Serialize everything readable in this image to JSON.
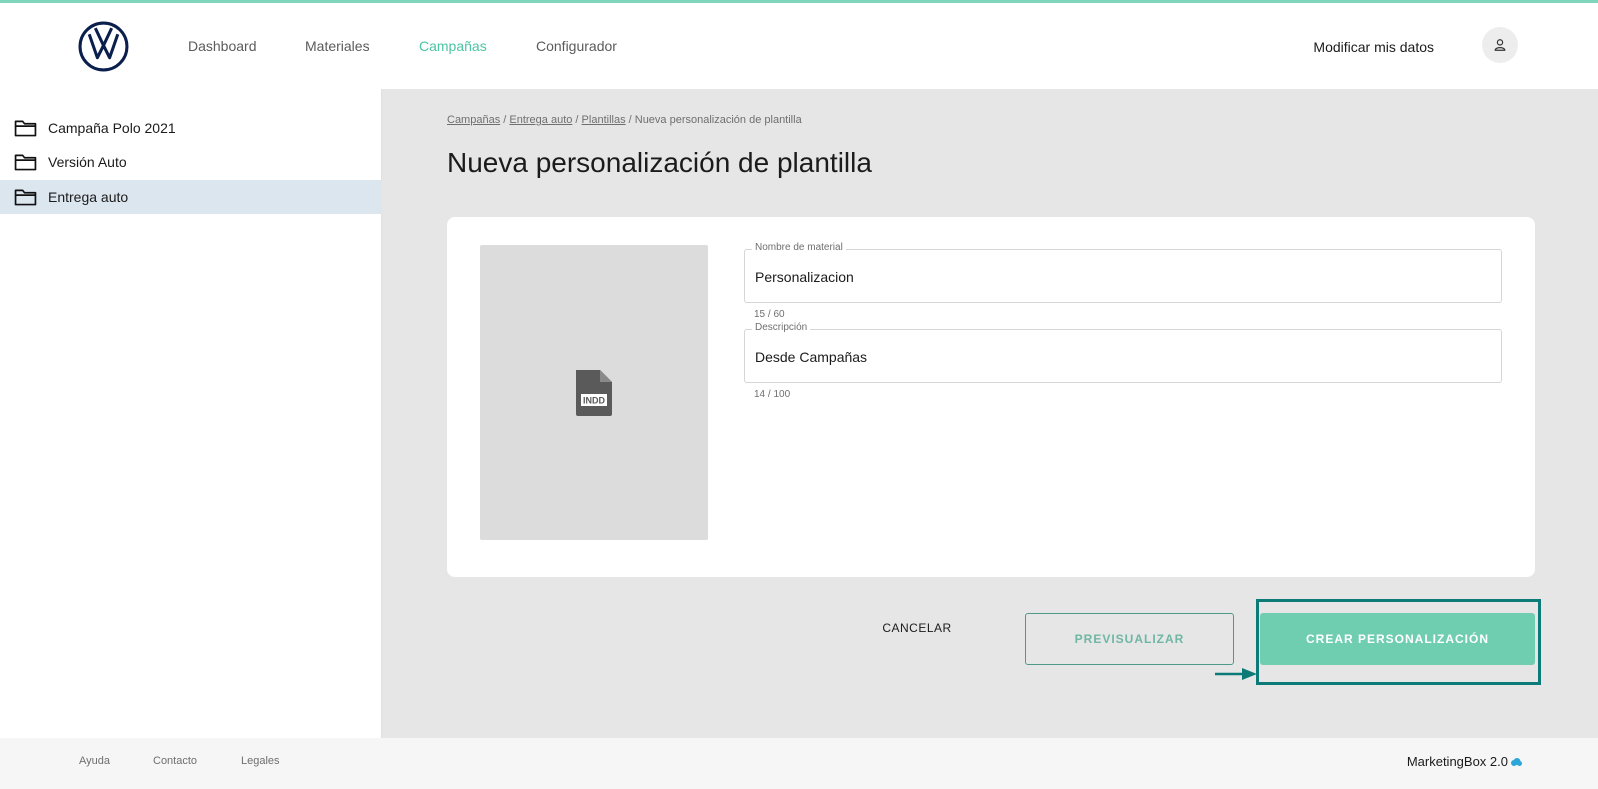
{
  "header": {
    "nav": [
      {
        "label": "Dashboard",
        "active": false
      },
      {
        "label": "Materiales",
        "active": false
      },
      {
        "label": "Campañas",
        "active": true
      },
      {
        "label": "Configurador",
        "active": false
      }
    ],
    "profile_label": "Modificar mis datos"
  },
  "sidebar": {
    "items": [
      {
        "label": "Campaña Polo 2021",
        "selected": false
      },
      {
        "label": "Versión Auto",
        "selected": false
      },
      {
        "label": "Entrega auto",
        "selected": true
      }
    ]
  },
  "main": {
    "breadcrumb": {
      "links": [
        "Campañas",
        "Entrega auto",
        "Plantillas"
      ],
      "separator": " / ",
      "current": "Nueva personalización de plantilla"
    },
    "title": "Nueva personalización de plantilla",
    "thumbnail_file_type": "INDD",
    "form": {
      "name_field": {
        "label": "Nombre de material",
        "value": "Personalizacion",
        "counter": "15 / 60"
      },
      "description_field": {
        "label": "Descripción",
        "value": "Desde Campañas",
        "counter": "14 / 100"
      }
    },
    "actions": {
      "cancel_label": "CANCELAR",
      "preview_label": "PREVISUALIZAR",
      "create_label": "CREAR PERSONALIZACIÓN"
    }
  },
  "footer": {
    "links": [
      "Ayuda",
      "Contacto",
      "Legales"
    ],
    "brand": "MarketingBox 2.0"
  },
  "colors": {
    "accent": "#6fcdb0",
    "nav_active": "#4cc3a3",
    "highlight": "#0c7b78",
    "sidebar_selected": "#dce6ef",
    "main_bg": "#e6e6e6",
    "logo": "#0b1f4d"
  }
}
